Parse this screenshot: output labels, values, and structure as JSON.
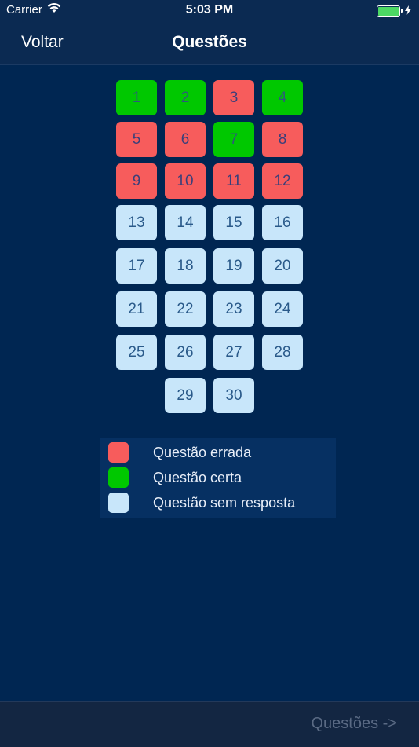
{
  "status_bar": {
    "carrier": "Carrier",
    "time": "5:03 PM",
    "battery_level": 1.0
  },
  "nav": {
    "back_label": "Voltar",
    "title": "Questões"
  },
  "questions": {
    "rows": [
      [
        {
          "n": "1",
          "state": "green"
        },
        {
          "n": "2",
          "state": "green"
        },
        {
          "n": "3",
          "state": "red"
        },
        {
          "n": "4",
          "state": "green"
        }
      ],
      [
        {
          "n": "5",
          "state": "red"
        },
        {
          "n": "6",
          "state": "red"
        },
        {
          "n": "7",
          "state": "green"
        },
        {
          "n": "8",
          "state": "red"
        }
      ],
      [
        {
          "n": "9",
          "state": "red"
        },
        {
          "n": "10",
          "state": "red"
        },
        {
          "n": "11",
          "state": "red"
        },
        {
          "n": "12",
          "state": "red"
        }
      ],
      [
        {
          "n": "13",
          "state": "blue"
        },
        {
          "n": "14",
          "state": "blue"
        },
        {
          "n": "15",
          "state": "blue"
        },
        {
          "n": "16",
          "state": "blue"
        }
      ],
      [
        {
          "n": "17",
          "state": "blue"
        },
        {
          "n": "18",
          "state": "blue"
        },
        {
          "n": "19",
          "state": "blue"
        },
        {
          "n": "20",
          "state": "blue"
        }
      ],
      [
        {
          "n": "21",
          "state": "blue"
        },
        {
          "n": "22",
          "state": "blue"
        },
        {
          "n": "23",
          "state": "blue"
        },
        {
          "n": "24",
          "state": "blue"
        }
      ],
      [
        {
          "n": "25",
          "state": "blue"
        },
        {
          "n": "26",
          "state": "blue"
        },
        {
          "n": "27",
          "state": "blue"
        },
        {
          "n": "28",
          "state": "blue"
        }
      ],
      [
        {
          "n": "29",
          "state": "blue"
        },
        {
          "n": "30",
          "state": "blue"
        }
      ]
    ]
  },
  "legend": {
    "wrong_label": "Questão errada",
    "right_label": "Questão certa",
    "unanswered_label": "Questão sem resposta"
  },
  "colors": {
    "wrong": "#f75c5c",
    "right": "#00c800",
    "unanswered": "#c8e6fa",
    "background": "#002652"
  },
  "bottom_bar": {
    "next_label": "Questões ->"
  }
}
